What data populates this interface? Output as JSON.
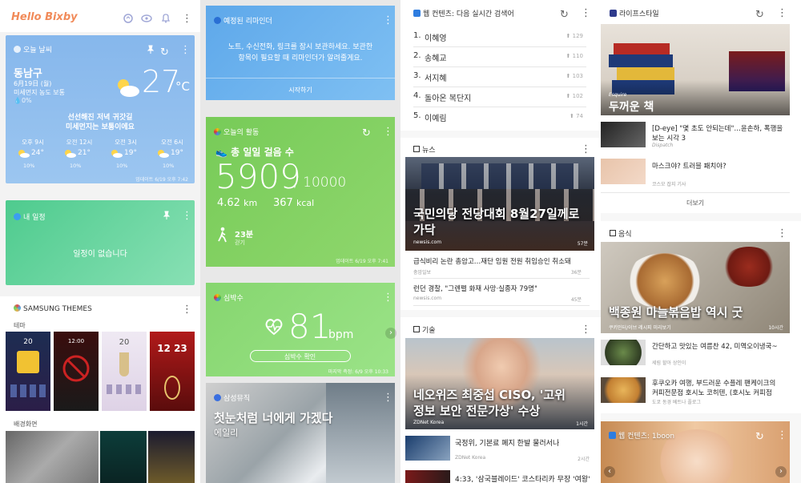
{
  "header": {
    "logo": "Hello Bixby"
  },
  "weather": {
    "title": "오늘 날씨",
    "location": "동남구",
    "date": "6月19日 (월)",
    "dust": "미세먼지 농도 보통",
    "rain": "0%",
    "temp": "27",
    "unit": "°C",
    "message_line1": "선선해진 저녁 귀갓길",
    "message_line2": "미세먼지는 보통이에요",
    "hours": [
      {
        "time": "오후 9시",
        "temp": "24°",
        "rain": "10%"
      },
      {
        "time": "오전 12시",
        "temp": "21°",
        "rain": "10%"
      },
      {
        "time": "오전 3시",
        "temp": "19°",
        "rain": "10%"
      },
      {
        "time": "오전 6시",
        "temp": "19°",
        "rain": "10%"
      }
    ],
    "updated": "업데이트 6/19 오후 7:42"
  },
  "schedule": {
    "title": "내 일정",
    "empty": "일정이 없습니다"
  },
  "themes": {
    "title": "SAMSUNG THEMES",
    "theme_label": "테마",
    "wallpaper_label": "배경화면",
    "cards": [
      "20",
      "12:00",
      "20",
      "12 23"
    ]
  },
  "reminder": {
    "title": "예정된 리마인더",
    "body_line1": "노트, 수신전화, 링크를 잠시 보관하세요. 보관한",
    "body_line2": "항목이 필요할 때 리마인더가 알려줄게요.",
    "action": "시작하기"
  },
  "activity": {
    "title": "오늘의 활동",
    "steps_label": "총 일일 걸음 수",
    "steps": "5909",
    "goal": "/ 10000",
    "km_value": "4.62",
    "km_unit": "km",
    "kcal_value": "367",
    "kcal_unit": "kcal",
    "walk_time": "23분",
    "walk_label": "걷기",
    "updated": "업데이트 6/19 오후 7:41"
  },
  "heart": {
    "title": "심박수",
    "bpm": "81",
    "unit": "bpm",
    "action": "심박수 확인",
    "measured": "마지막 측정: 6/9 오후 10:33"
  },
  "music": {
    "title": "삼성뮤직",
    "song": "첫눈처럼 너에게 가겠다",
    "artist": "에일리"
  },
  "realtime": {
    "title": "웹 컨텐츠: 다음 실시간 검색어",
    "items": [
      {
        "rank": "1.",
        "term": "이혜영",
        "count": "129"
      },
      {
        "rank": "2.",
        "term": "송혜교",
        "count": "110"
      },
      {
        "rank": "3.",
        "term": "서지혜",
        "count": "103"
      },
      {
        "rank": "4.",
        "term": "돌아온 복단지",
        "count": "102"
      },
      {
        "rank": "5.",
        "term": "이예림",
        "count": "74"
      }
    ]
  },
  "news": {
    "title": "뉴스",
    "headline_line1": "국민의당 전당대회 8월27일께로",
    "headline_line2": "가닥",
    "source": "newsis.com",
    "time": "57분",
    "items": [
      {
        "title": "급식비리 논란 총암고…재단 임원 전원 취임승인 취소돼",
        "source": "충암일보",
        "time": "36분"
      },
      {
        "title": "런던 경찰, \"그렌펠 화재 사망·실종자 79명\"",
        "source": "newsis.com",
        "time": "45분"
      }
    ]
  },
  "tech": {
    "title": "기술",
    "headline_line1": "네오위즈 최중섭 CISO, '고위",
    "headline_line2": "정보 보안 전문가상' 수상",
    "source": "ZDNet Korea",
    "time": "1시간",
    "items": [
      {
        "title": "국정위, 기본료 폐지 한발 물러서나",
        "source": "ZDNet Korea",
        "time": "2시간"
      },
      {
        "title": "4:33, '삼국블레이드' 코스타리카 무장 '여왕'",
        "source": "",
        "time": ""
      }
    ]
  },
  "lifestyle": {
    "title": "라이프스타일",
    "badge": "Esquire",
    "headline": "두꺼운 책",
    "items": [
      {
        "title_line1": "[D-eye] \"몇 초도 안되는데\"…윤손하, 폭행을",
        "title_line2": "보는 시각 3",
        "source": "Dispatch"
      },
      {
        "title_line1": "마스크야? 트러블 패치야?",
        "title_line2": "",
        "source": "코스모 잡지 기사"
      }
    ],
    "more": "더보기"
  },
  "food": {
    "title": "음식",
    "headline": "백종원 마늘볶음밥 역시 굿",
    "source": "쿠키인터/이브 레시피 미리보기",
    "time": "10시간",
    "items": [
      {
        "title": "간단하고 맛있는 여름찬 42, 미역오이냉국~",
        "source": "세림 할아 상인이"
      },
      {
        "title_line1": "후쿠오카 여행, 부드러운 수플레 팬케이크의",
        "title_line2": "커피전문점 호시노 코히텐, (호시노 커피점",
        "source": "도쿄 동경 베트나 플로그"
      }
    ]
  },
  "oneboon": {
    "title": "웹 컨텐츠: 1boon"
  },
  "colors": {
    "weather": "#7fb2ea",
    "schedule": "#5fd39a",
    "reminder": "#6cb0ec",
    "activity": "#84d266",
    "heart": "#90dc7a"
  }
}
